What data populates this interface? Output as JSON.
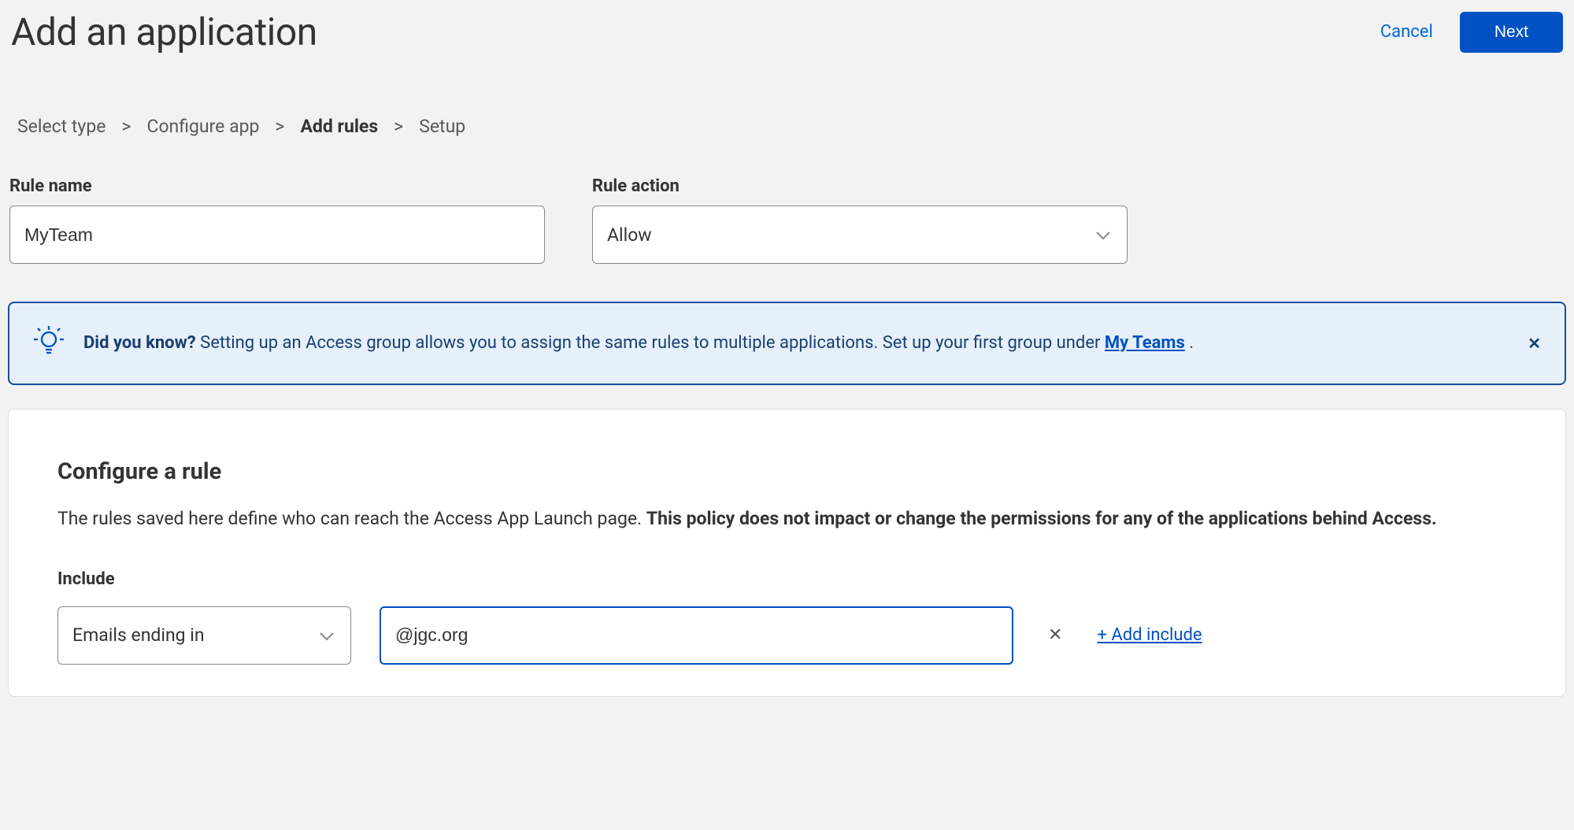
{
  "header": {
    "title": "Add an application",
    "cancel_label": "Cancel",
    "next_label": "Next"
  },
  "breadcrumb": {
    "steps": [
      "Select type",
      "Configure app",
      "Add rules",
      "Setup"
    ],
    "active_index": 2
  },
  "form": {
    "rule_name_label": "Rule name",
    "rule_name_value": "MyTeam",
    "rule_action_label": "Rule action",
    "rule_action_value": "Allow"
  },
  "banner": {
    "prefix": "Did you know?",
    "text": "Setting up an Access group allows you to assign the same rules to multiple applications. Set up your first group under ",
    "link_label": "My Teams",
    "suffix": " ."
  },
  "rule_card": {
    "title": "Configure a rule",
    "desc_plain": "The rules saved here define who can reach the Access App Launch page. ",
    "desc_bold": "This policy does not impact or change the permissions for any of the applications behind Access.",
    "include_label": "Include",
    "include_type": "Emails ending in",
    "include_value": "@jgc.org",
    "add_include_label": "+ Add include"
  }
}
